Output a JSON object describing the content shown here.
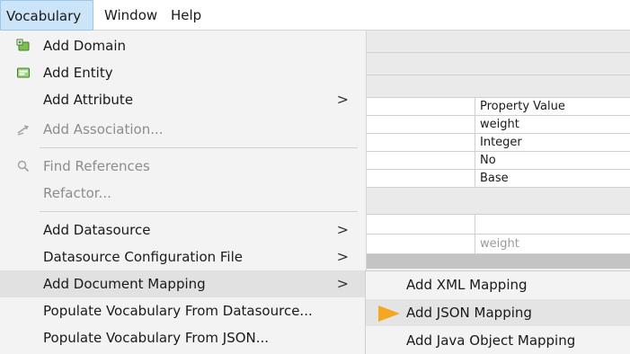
{
  "menubar": {
    "items": [
      "Vocabulary",
      "Window",
      "Help"
    ]
  },
  "main_menu": {
    "add_domain": "Add Domain",
    "add_entity": "Add Entity",
    "add_attribute": "Add Attribute",
    "add_association": "Add Association...",
    "find_references": "Find References",
    "refactor": "Refactor...",
    "add_datasource": "Add Datasource",
    "datasource_config": "Datasource Configuration File",
    "add_document_mapping": "Add Document Mapping",
    "populate_from_datasource": "Populate Vocabulary From Datasource...",
    "populate_from_json": "Populate Vocabulary From JSON...",
    "submenu_arrow": ">"
  },
  "submenu": {
    "items": [
      "Add XML Mapping",
      "Add JSON Mapping",
      "Add Java Object Mapping"
    ]
  },
  "properties": {
    "header": "Property Value",
    "values": [
      "weight",
      "Integer",
      "No",
      "Base"
    ],
    "field_value": "weight"
  },
  "colors": {
    "menu_highlight": "#e1e1e1",
    "menubar_selected": "#cce4f7",
    "pointer_orange": "#f5a623"
  }
}
